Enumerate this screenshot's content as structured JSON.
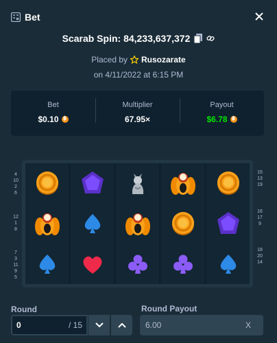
{
  "modal": {
    "title": "Bet"
  },
  "spin": {
    "title": "Scarab Spin: 84,233,637,372"
  },
  "placed": {
    "prefix": "Placed by",
    "user": "Rusozarate",
    "date": "on 4/11/2022 at 6:15 PM"
  },
  "stats": {
    "bet": {
      "label": "Bet",
      "value": "$0.10"
    },
    "multiplier": {
      "label": "Multiplier",
      "value": "67.95×"
    },
    "payout": {
      "label": "Payout",
      "value": "$6.78"
    }
  },
  "paylines": {
    "left_top": [
      "4",
      "10",
      "2",
      "6"
    ],
    "left_mid": [
      "12",
      "1",
      "8"
    ],
    "left_bot": [
      "7",
      "3",
      "11",
      "9",
      "5"
    ],
    "right_top": [
      "15",
      "13",
      "19"
    ],
    "right_mid": [
      "16",
      "17",
      "9"
    ],
    "right_bot": [
      "18",
      "20",
      "14"
    ]
  },
  "reels": [
    [
      "coin",
      "scarab",
      "spade"
    ],
    [
      "gem",
      "spade",
      "heart"
    ],
    [
      "cat",
      "scarab",
      "club"
    ],
    [
      "scarab",
      "coin",
      "club"
    ],
    [
      "coin",
      "gem",
      "spade"
    ]
  ],
  "round": {
    "label": "Round",
    "value": "0",
    "total": "/ 15"
  },
  "round_payout": {
    "label": "Round Payout",
    "value": "6.00",
    "clear": "X"
  },
  "colors": {
    "bg": "#1a2c38",
    "panel": "#0f212e",
    "green": "#00e701",
    "coin": "#f7931a"
  }
}
